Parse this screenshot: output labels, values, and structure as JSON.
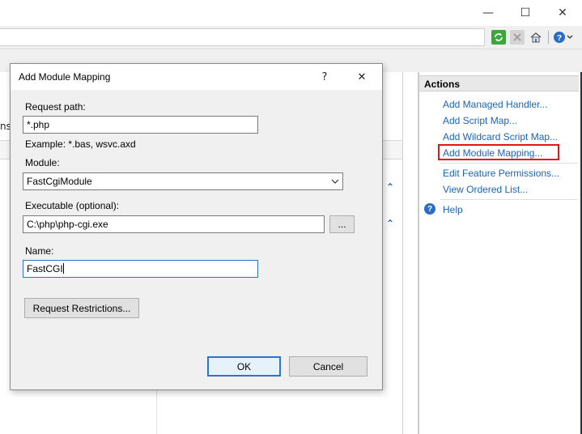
{
  "window": {
    "minimize_glyph": "—",
    "maximize_glyph": "☐",
    "close_glyph": "✕"
  },
  "toolbar": {
    "icons": [
      "refresh-icon",
      "stop-icon",
      "home-icon",
      "help-dropdown-icon"
    ]
  },
  "background": {
    "truncated_column_text": "ns"
  },
  "actions": {
    "title": "Actions",
    "links": [
      "Add Managed Handler...",
      "Add Script Map...",
      "Add Wildcard Script Map...",
      "Add Module Mapping...",
      "Edit Feature Permissions...",
      "View Ordered List..."
    ],
    "help_label": "Help",
    "highlight_color": "#e8121a"
  },
  "dialog": {
    "title": "Add Module Mapping",
    "help_glyph": "?",
    "close_glyph": "✕",
    "request_path_label": "Request path:",
    "request_path_value": "*.php",
    "example_text": "Example: *.bas, wsvc.axd",
    "module_label": "Module:",
    "module_value": "FastCgiModule",
    "executable_label": "Executable (optional):",
    "executable_value": "C:\\php\\php-cgi.exe",
    "browse_label": "...",
    "name_label": "Name:",
    "name_value": "FastCGI",
    "request_restrictions_label": "Request Restrictions...",
    "ok_label": "OK",
    "cancel_label": "Cancel"
  },
  "colors": {
    "link": "#1a64b8",
    "focus": "#2a74c9",
    "dialog_bg": "#f0f0f0"
  }
}
